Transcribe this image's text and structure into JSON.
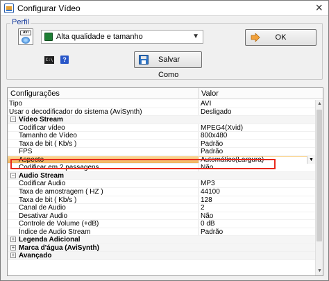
{
  "window": {
    "title": "Configurar Vídeo"
  },
  "profile": {
    "group_label": "Perfil",
    "format_badge": "AVI",
    "selected_profile": "Alta qualidade e tamanho",
    "ok_label": "OK",
    "save_as_label": "Salvar Como",
    "cli_badge": "C:\\",
    "help_badge": "?"
  },
  "grid": {
    "col_config": "Configurações",
    "col_value": "Valor",
    "rows": [
      {
        "type": "prop",
        "key": "Tipo",
        "value": "AVI"
      },
      {
        "type": "prop",
        "key": "Usar o decodificador do sistema (AviSynth)",
        "value": "Desligado"
      },
      {
        "type": "cat",
        "key": "Vídeo Stream",
        "expander": "−"
      },
      {
        "type": "child",
        "key": "Codificar vídeo",
        "value": "MPEG4(Xvid)"
      },
      {
        "type": "child",
        "key": "Tamanho de Vídeo",
        "value": "800x480"
      },
      {
        "type": "child",
        "key": "Taxa de bit ( Kb/s )",
        "value": "Padrão"
      },
      {
        "type": "child",
        "key": "FPS",
        "value": "Padrão"
      },
      {
        "type": "selected",
        "key": "Aspecto",
        "value": "Automático(Largura)"
      },
      {
        "type": "child",
        "key": "Codificar em 2 passagens",
        "value": "Não"
      },
      {
        "type": "cat",
        "key": "Audio Stream",
        "expander": "−"
      },
      {
        "type": "child",
        "key": "Codificar Audio",
        "value": "MP3"
      },
      {
        "type": "child",
        "key": "Taxa de amostragem ( HZ )",
        "value": "44100"
      },
      {
        "type": "child",
        "key": "Taxa de bit ( Kb/s )",
        "value": "128"
      },
      {
        "type": "child",
        "key": "Canal de Audio",
        "value": "2"
      },
      {
        "type": "child",
        "key": "Desativar Audio",
        "value": "Não"
      },
      {
        "type": "child",
        "key": "Controle de Volume (+dB)",
        "value": "0 dB"
      },
      {
        "type": "child",
        "key": "Índice de Audio Stream",
        "value": "Padrão"
      },
      {
        "type": "cat",
        "key": "Legenda Adicional",
        "expander": "+"
      },
      {
        "type": "cat",
        "key": "Marca d'água (AviSynth)",
        "expander": "+"
      },
      {
        "type": "cat",
        "key": "Avançado",
        "expander": "+"
      }
    ]
  },
  "colors": {
    "highlight": "#e8291c",
    "selected_row": "#f2b25c"
  }
}
